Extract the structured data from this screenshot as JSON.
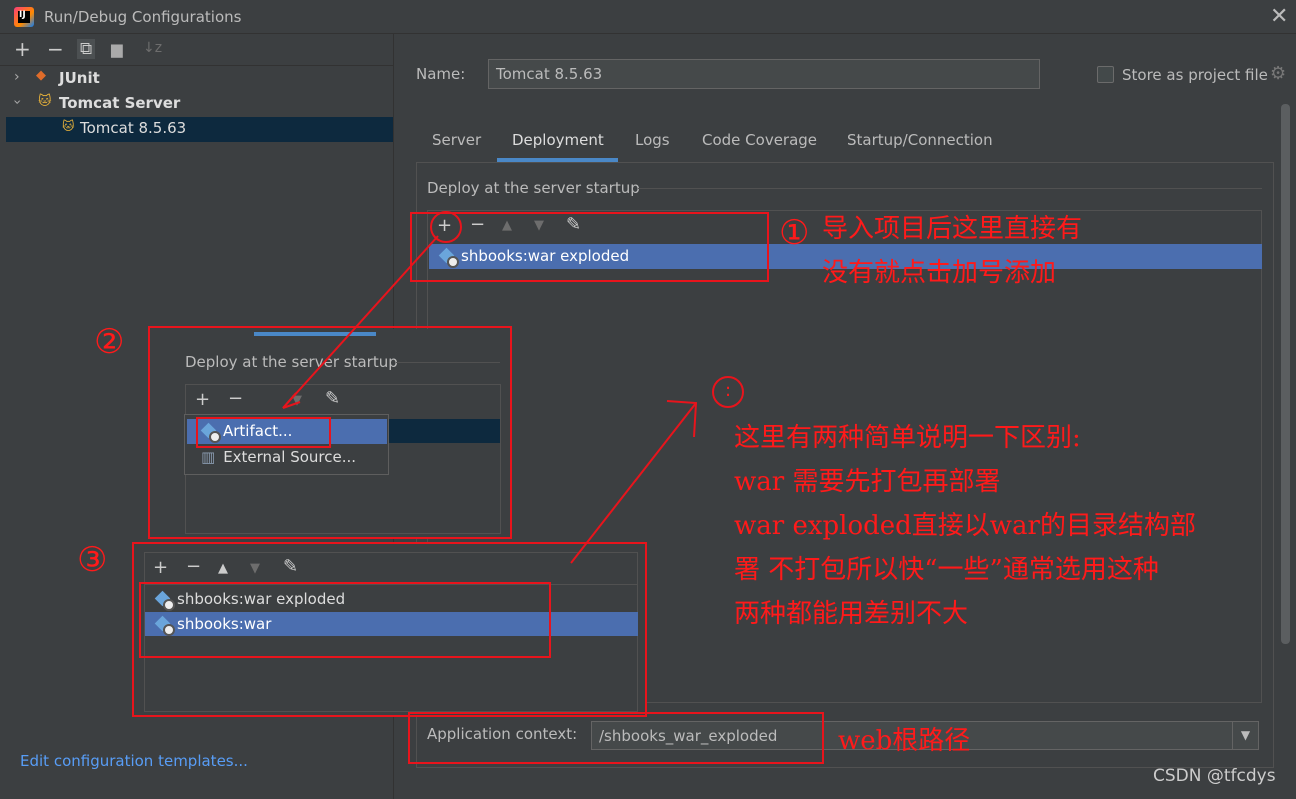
{
  "window": {
    "title": "Run/Debug Configurations"
  },
  "left_toolbar": {
    "add": "+",
    "remove": "−",
    "copy": "⧉",
    "folder": "📁",
    "sort": "↓z"
  },
  "tree": {
    "junit": "JUnit",
    "tomcat_server": "Tomcat Server",
    "tomcat_config": "Tomcat 8.5.63"
  },
  "edit_templates": "Edit configuration templates...",
  "form": {
    "name_label": "Name:",
    "name_value": "Tomcat 8.5.63",
    "store_label": "Store as project file"
  },
  "tabs": [
    "Server",
    "Deployment",
    "Logs",
    "Code Coverage",
    "Startup/Connection"
  ],
  "deploy": {
    "section_title": "Deploy at the server startup",
    "artifact": "shbooks:war exploded"
  },
  "inset2": {
    "section_title": "Deploy at the server startup",
    "menu_artifact": "Artifact...",
    "menu_external": "External Source..."
  },
  "inset3": {
    "item1": "shbooks:war exploded",
    "item2": "shbooks:war"
  },
  "app_context": {
    "label": "Application context:",
    "value": "/shbooks_war_exploded"
  },
  "annotations": {
    "num1": "①",
    "num2": "②",
    "num3": "③",
    "note1_line1": "导入项目后这里直接有",
    "note1_line2": "没有就点击加号添加",
    "colon": ":",
    "note2_line1": "这里有两种简单说明一下区别:",
    "note2_line2": "war 需要先打包再部署",
    "note2_line3": "war exploded直接以war的目录结构部",
    "note2_line4": "署 不打包所以快“一些”通常选用这种",
    "note2_line5": "两种都能用差别不大",
    "web_root": "web根路径"
  },
  "watermark": "CSDN @tfcdys",
  "colors": {
    "accent": "#4a88c7",
    "selection": "#4b6eaf",
    "annotation": "#e8141c"
  }
}
